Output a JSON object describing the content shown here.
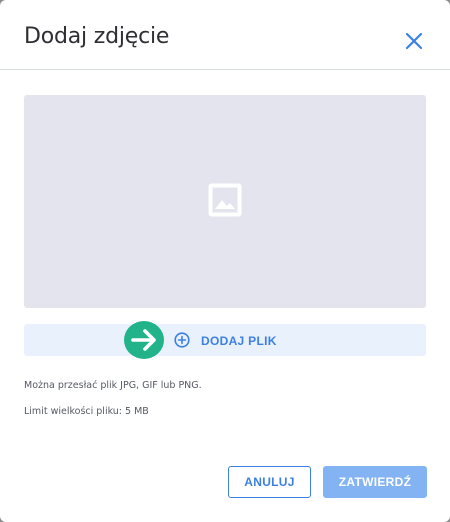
{
  "dialog": {
    "title": "Dodaj zdjęcie",
    "close_icon": "close-icon"
  },
  "preview": {
    "icon": "image-placeholder-icon"
  },
  "upload": {
    "label": "DODAJ PLIK",
    "arrow_icon": "arrow-right-icon",
    "plus_icon": "plus-circle-icon"
  },
  "info": {
    "formats": "Można przesłać plik JPG, GIF lub PNG.",
    "size_limit": "Limit wielkości pliku: 5 MB"
  },
  "footer": {
    "cancel_label": "ANULUJ",
    "confirm_label": "ZATWIERDŹ"
  },
  "colors": {
    "accent": "#3c80e6",
    "accent_disabled": "#84b3f3",
    "preview_bg": "#e3e4ee",
    "upload_bg": "#e9f1fc",
    "arrow_bg": "#22b38a"
  }
}
